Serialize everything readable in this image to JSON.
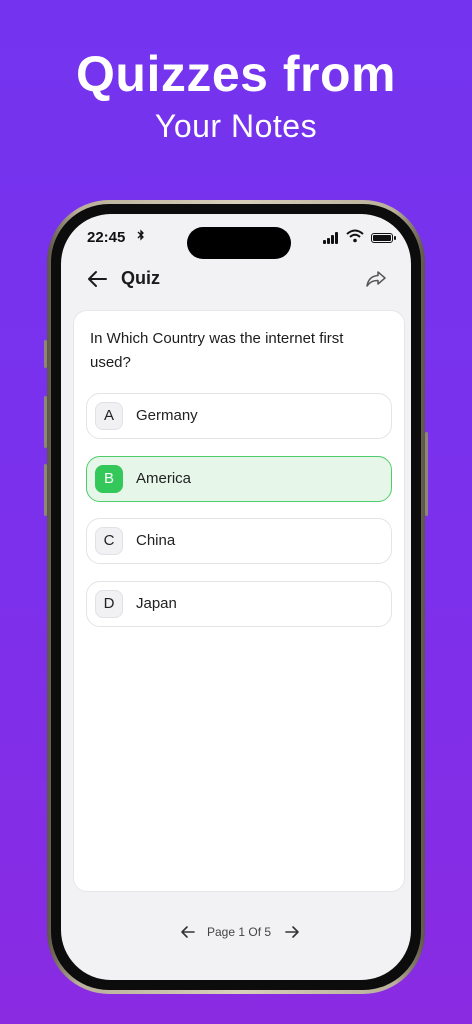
{
  "promo": {
    "headline": "Quizzes from",
    "subheadline": "Your Notes"
  },
  "status_bar": {
    "time": "22:45",
    "icons": [
      "bluetooth-icon",
      "signal-icon",
      "wifi-icon",
      "battery-icon"
    ]
  },
  "nav": {
    "back_icon": "arrow-left-icon",
    "title": "Quiz",
    "share_icon": "share-arrow-icon"
  },
  "quiz": {
    "question": "In Which Country was the internet first used?",
    "options": [
      {
        "letter": "A",
        "text": "Germany",
        "selected": false
      },
      {
        "letter": "B",
        "text": "America",
        "selected": true
      },
      {
        "letter": "C",
        "text": "China",
        "selected": false
      },
      {
        "letter": "D",
        "text": "Japan",
        "selected": false
      }
    ]
  },
  "pager": {
    "label": "Page 1 Of 5",
    "current_page": 1,
    "total_pages": 5
  },
  "colors": {
    "background": "#7434ef",
    "selected_fill": "#e6f7ea",
    "selected_border": "#4fcc6a",
    "selected_badge": "#34c759"
  }
}
